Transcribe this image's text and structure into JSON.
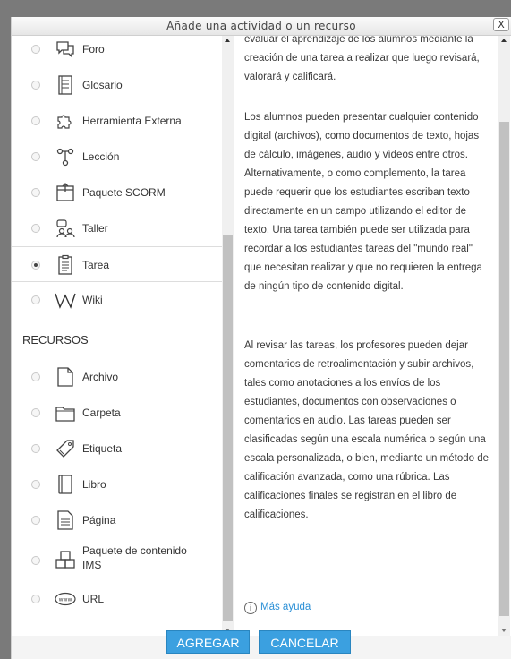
{
  "dialog": {
    "title": "Añade una actividad o un recurso",
    "close_label": "X"
  },
  "activities": [
    {
      "label": "Foro",
      "icon": "forum-icon",
      "selected": false
    },
    {
      "label": "Glosario",
      "icon": "glossary-icon",
      "selected": false
    },
    {
      "label": "Herramienta Externa",
      "icon": "puzzle-icon",
      "selected": false
    },
    {
      "label": "Lección",
      "icon": "lesson-icon",
      "selected": false
    },
    {
      "label": "Paquete SCORM",
      "icon": "scorm-package-icon",
      "selected": false
    },
    {
      "label": "Taller",
      "icon": "workshop-icon",
      "selected": false
    },
    {
      "label": "Tarea",
      "icon": "assignment-icon",
      "selected": true
    },
    {
      "label": "Wiki",
      "icon": "wiki-icon",
      "selected": false
    }
  ],
  "resources_header": "RECURSOS",
  "resources": [
    {
      "label": "Archivo",
      "icon": "file-icon"
    },
    {
      "label": "Carpeta",
      "icon": "folder-icon"
    },
    {
      "label": "Etiqueta",
      "icon": "label-tag-icon"
    },
    {
      "label": "Libro",
      "icon": "book-icon"
    },
    {
      "label": "Página",
      "icon": "page-icon"
    },
    {
      "label": "Paquete de contenido IMS",
      "icon": "ims-package-icon"
    },
    {
      "label": "URL",
      "icon": "url-icon"
    }
  ],
  "help": {
    "paragraphs": [
      "evaluar el aprendizaje de los alumnos mediante la creación de una tarea a realizar que luego revisará, valorará y calificará.",
      "Los alumnos pueden presentar cualquier contenido digital (archivos), como documentos de texto, hojas de cálculo, imágenes, audio y vídeos entre otros. Alternativamente, o como complemento, la tarea puede requerir que los estudiantes escriban texto directamente en un campo utilizando el editor de texto. Una tarea también puede ser utilizada para recordar a los estudiantes tareas del \"mundo real\" que necesitan realizar y que no requieren la entrega de ningún tipo de contenido digital.",
      "Al revisar las tareas, los profesores pueden dejar comentarios de retroalimentación y subir archivos, tales como anotaciones a los envíos de los estudiantes, documentos con observaciones o comentarios en audio. Las tareas pueden ser clasificadas según una escala numérica o según una escala personalizada, o bien, mediante un método de calificación avanzada, como una rúbrica. Las calificaciones finales se registran en el libro de calificaciones."
    ],
    "more_help": "Más ayuda",
    "info_glyph": "i"
  },
  "footer": {
    "add_label": "AGREGAR",
    "cancel_label": "CANCELAR"
  },
  "colors": {
    "button": "#3ba0e0",
    "link": "#2a8fd6"
  }
}
